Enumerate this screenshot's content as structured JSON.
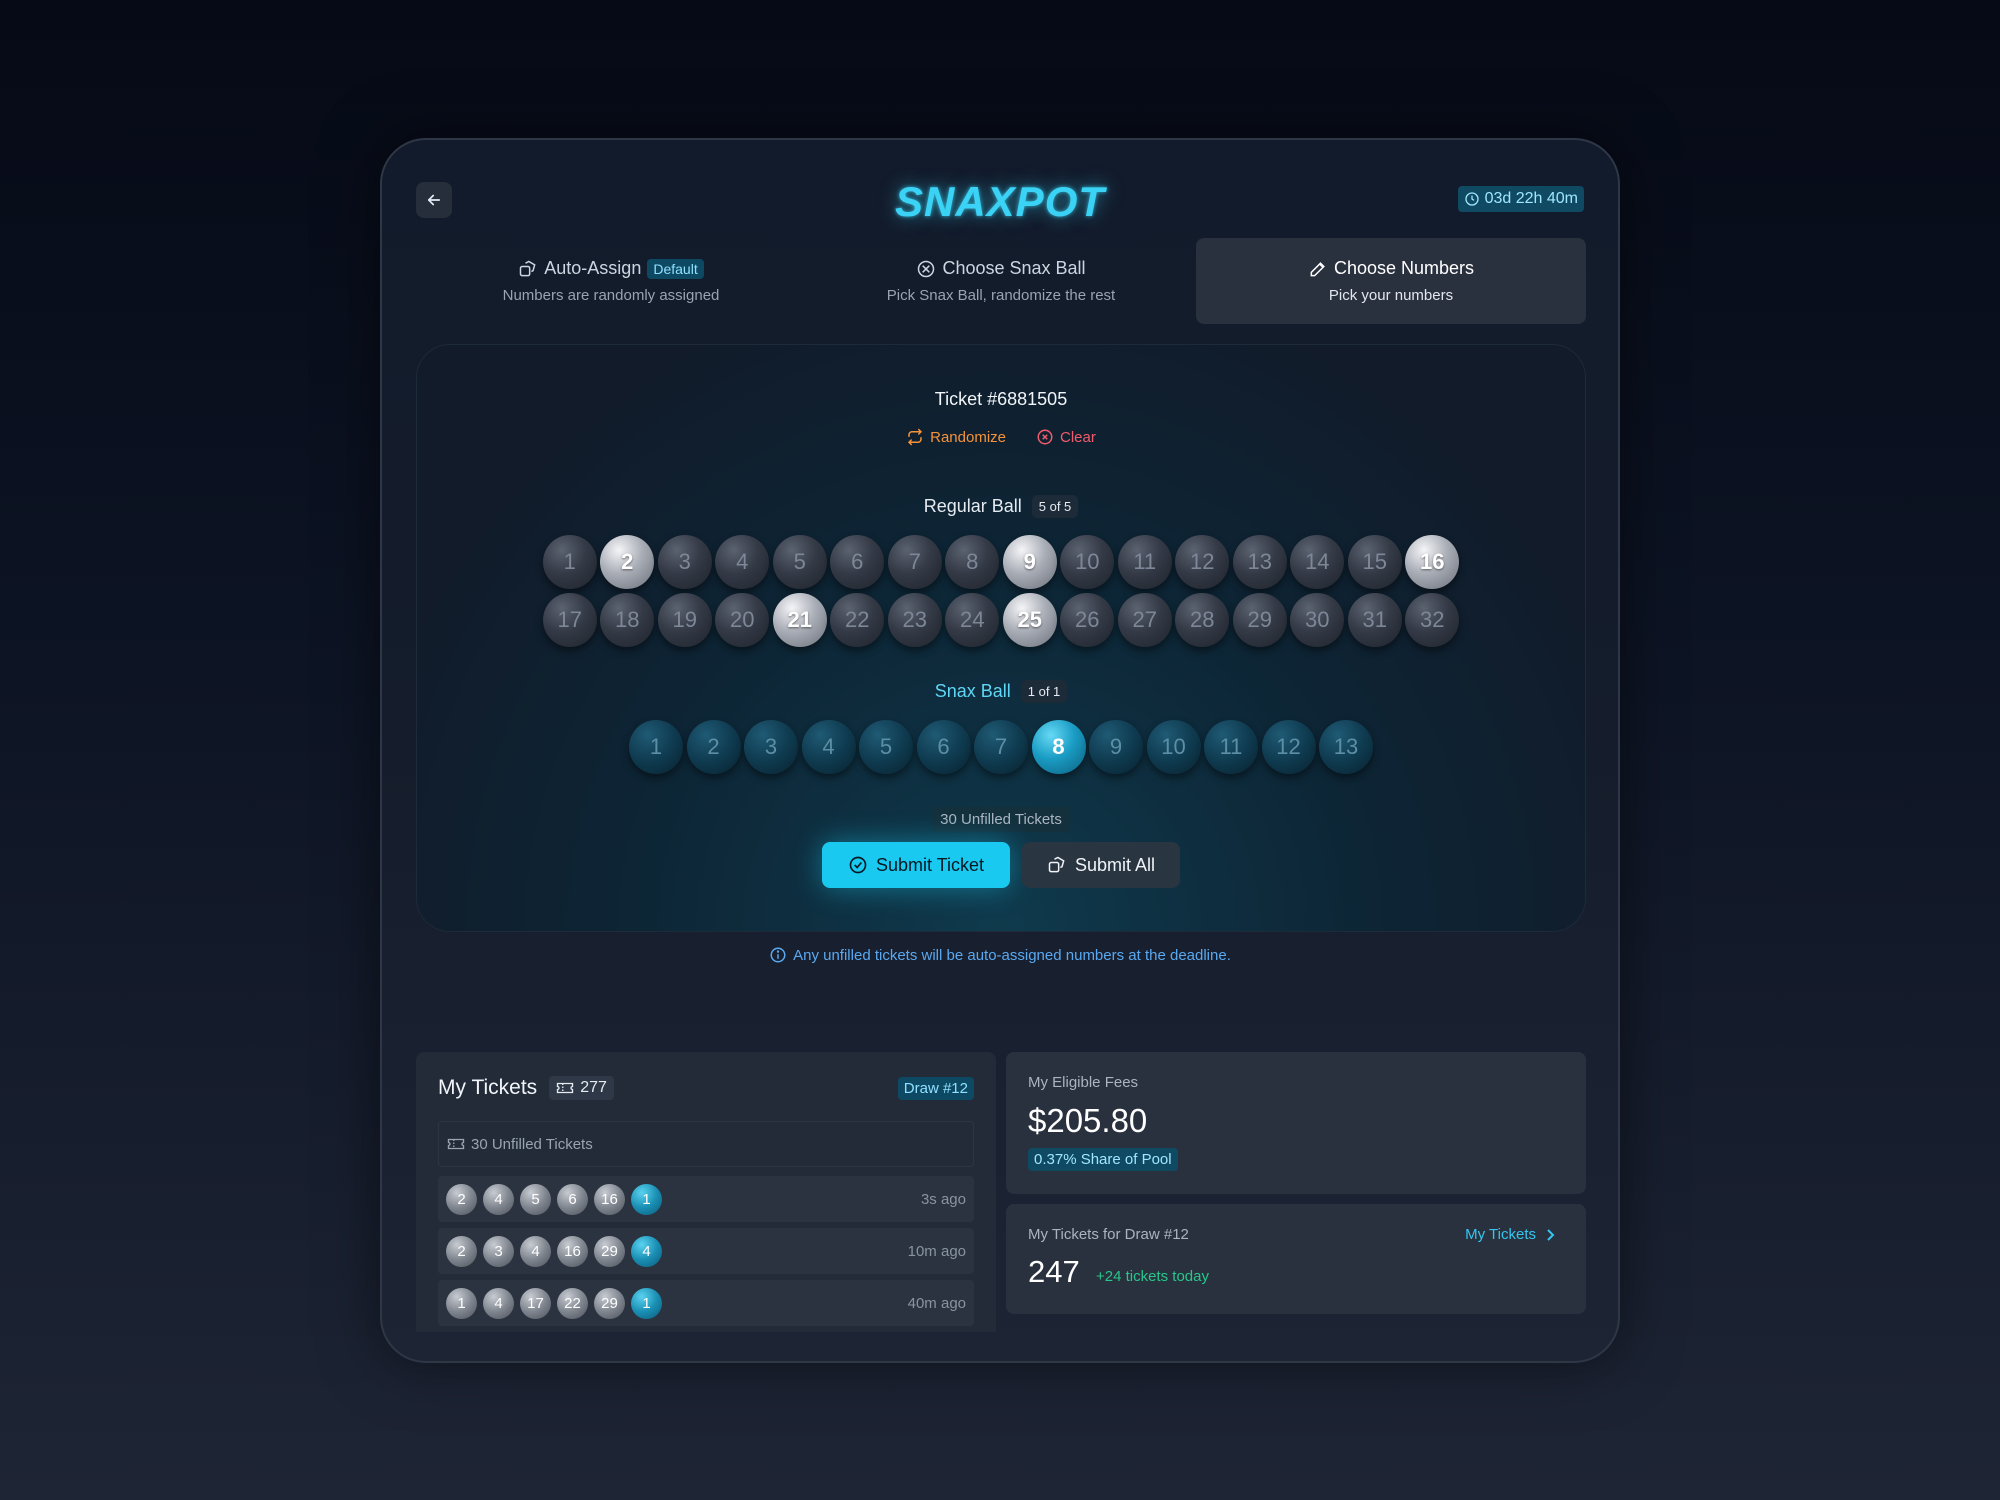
{
  "header": {
    "logo": "SNAXPOT",
    "timer": "03d 22h 40m"
  },
  "tabs": [
    {
      "title": "Auto-Assign",
      "badge": "Default",
      "subtitle": "Numbers are randomly assigned",
      "icon": "dice-icon"
    },
    {
      "title": "Choose Snax Ball",
      "subtitle": "Pick Snax Ball, randomize the rest",
      "icon": "snax-ball-icon"
    },
    {
      "title": "Choose Numbers",
      "subtitle": "Pick your numbers",
      "icon": "edit-icon",
      "active": true
    }
  ],
  "ticket": {
    "title": "Ticket #6881505",
    "randomize_label": "Randomize",
    "clear_label": "Clear",
    "regular_label": "Regular Ball",
    "regular_count": "5 of 5",
    "regular_balls": [
      "1",
      "2",
      "3",
      "4",
      "5",
      "6",
      "7",
      "8",
      "9",
      "10",
      "11",
      "12",
      "13",
      "14",
      "15",
      "16",
      "17",
      "18",
      "19",
      "20",
      "21",
      "22",
      "23",
      "24",
      "25",
      "26",
      "27",
      "28",
      "29",
      "30",
      "31",
      "32"
    ],
    "regular_selected": [
      "2",
      "9",
      "16",
      "21",
      "25"
    ],
    "snax_label": "Snax Ball",
    "snax_count": "1 of 1",
    "snax_balls": [
      "1",
      "2",
      "3",
      "4",
      "5",
      "6",
      "7",
      "8",
      "9",
      "10",
      "11",
      "12",
      "13"
    ],
    "snax_selected": [
      "8"
    ],
    "unfilled": "30 Unfilled Tickets",
    "submit_label": "Submit Ticket",
    "submit_all_label": "Submit All"
  },
  "info_note": "Any unfilled tickets will be auto-assigned numbers at the deadline.",
  "my_tickets": {
    "title": "My Tickets",
    "count": "277",
    "draw_badge": "Draw #12",
    "unfilled": "30 Unfilled Tickets",
    "rows": [
      {
        "numbers": [
          "2",
          "4",
          "5",
          "6",
          "16"
        ],
        "snax": "1",
        "time": "3s ago"
      },
      {
        "numbers": [
          "2",
          "3",
          "4",
          "16",
          "29"
        ],
        "snax": "4",
        "time": "10m ago"
      },
      {
        "numbers": [
          "1",
          "4",
          "17",
          "22",
          "29"
        ],
        "snax": "1",
        "time": "40m ago"
      }
    ]
  },
  "fees": {
    "label": "My Eligible Fees",
    "value": "$205.80",
    "share": "0.37% Share of Pool"
  },
  "draw_tickets": {
    "label": "My Tickets for Draw #12",
    "link": "My Tickets",
    "value": "247",
    "delta": "+24 tickets today"
  },
  "colors": {
    "accent": "#19c9ef",
    "randomize": "#f5933b",
    "clear": "#f15b6c",
    "positive": "#27c68a"
  }
}
